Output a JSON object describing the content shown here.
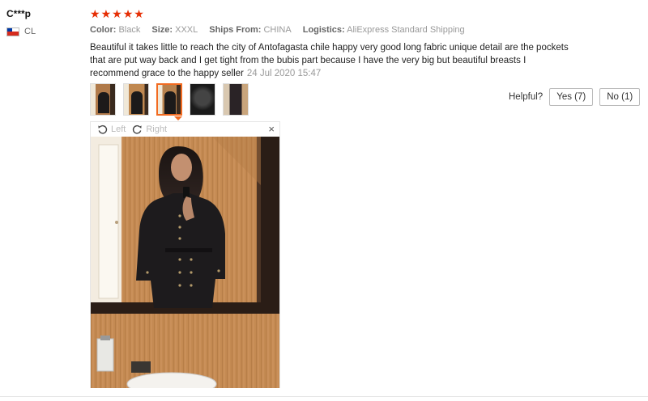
{
  "review": {
    "user": "C***p",
    "country": "CL",
    "rating": 5,
    "color_label": "Color:",
    "color_value": "Black",
    "size_label": "Size:",
    "size_value": "XXXL",
    "ships_label": "Ships From:",
    "ships_value": "CHINA",
    "logistics_label": "Logistics:",
    "logistics_value": "AliExpress Standard Shipping",
    "text": "Beautiful it takes little to reach the city of Antofagasta chile happy very good long fabric unique detail are the pockets that are put way back and I get tight from the bubis part because I have the very big but beautiful breasts I recommend grace to the happy seller",
    "date": "24 Jul 2020 15:47"
  },
  "helpful": {
    "label": "Helpful?",
    "yes_label": "Yes (7)",
    "no_label": "No (1)"
  },
  "viewer": {
    "rotate_left": "Left",
    "rotate_right": "Right",
    "close": "×"
  },
  "colors": {
    "star": "#e62e04",
    "active_thumb": "#f26b21"
  }
}
